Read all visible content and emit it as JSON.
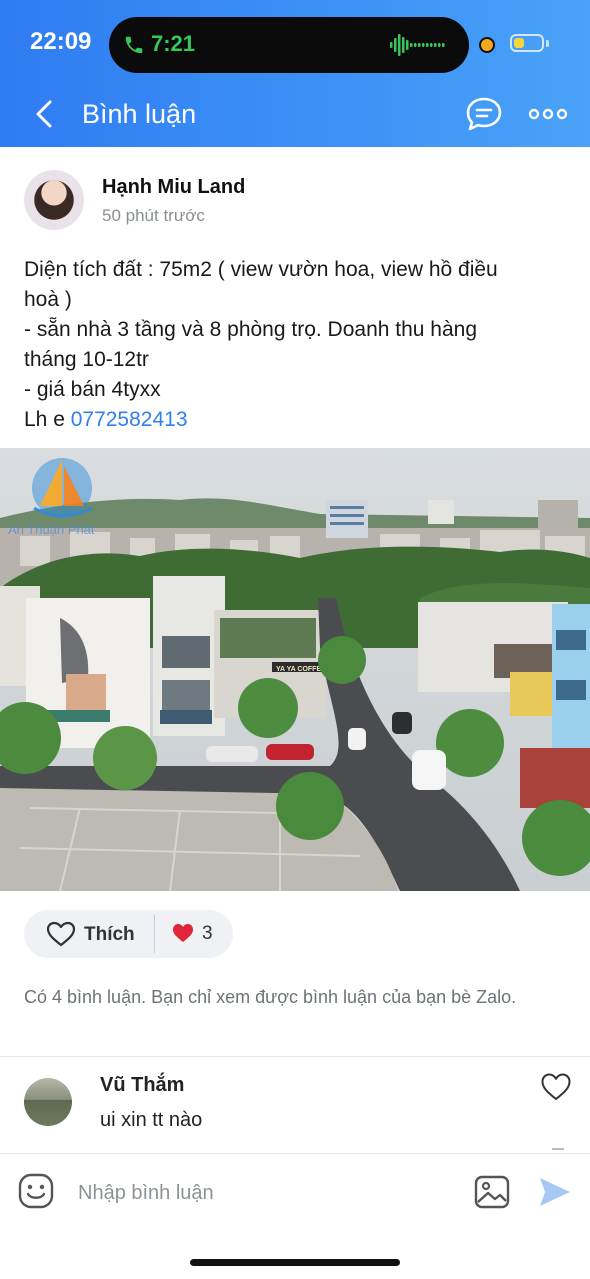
{
  "status_bar": {
    "time": "22:09",
    "call_duration": "7:21",
    "battery_color": "#f7d33c"
  },
  "header": {
    "title": "Bình luận",
    "back_icon": "chevron-left-icon",
    "chat_icon": "chat-bubble-icon",
    "more_icon": "more-horizontal-icon",
    "background": "#3a8af4"
  },
  "post": {
    "author": "Hạnh Miu Land",
    "time": "50 phút trước",
    "lines": [
      "Diện tích đất : 75m2 ( view vườn hoa, view hồ điều",
      "hoà )",
      "- sẵn nhà 3 tầng và 8 phòng trọ. Doanh thu hàng",
      "tháng 10-12tr",
      "- giá bán 4tyxx"
    ],
    "contact_prefix": "Lh e ",
    "phone": "0772582413",
    "photo_watermark": "An Thuận Phát",
    "photo_sign": "YA YA COFFEE"
  },
  "reactions": {
    "like_label": "Thích",
    "count": "3"
  },
  "comments": {
    "notice": "Có 4 bình luận. Bạn chỉ xem được bình luận của bạn bè Zalo.",
    "items": [
      {
        "author": "Vũ Thắm",
        "text": "ui xin tt nào"
      }
    ]
  },
  "composer": {
    "placeholder": "Nhập bình luận",
    "emoji_icon": "emoji-icon",
    "image_icon": "image-icon",
    "send_icon": "send-icon"
  }
}
